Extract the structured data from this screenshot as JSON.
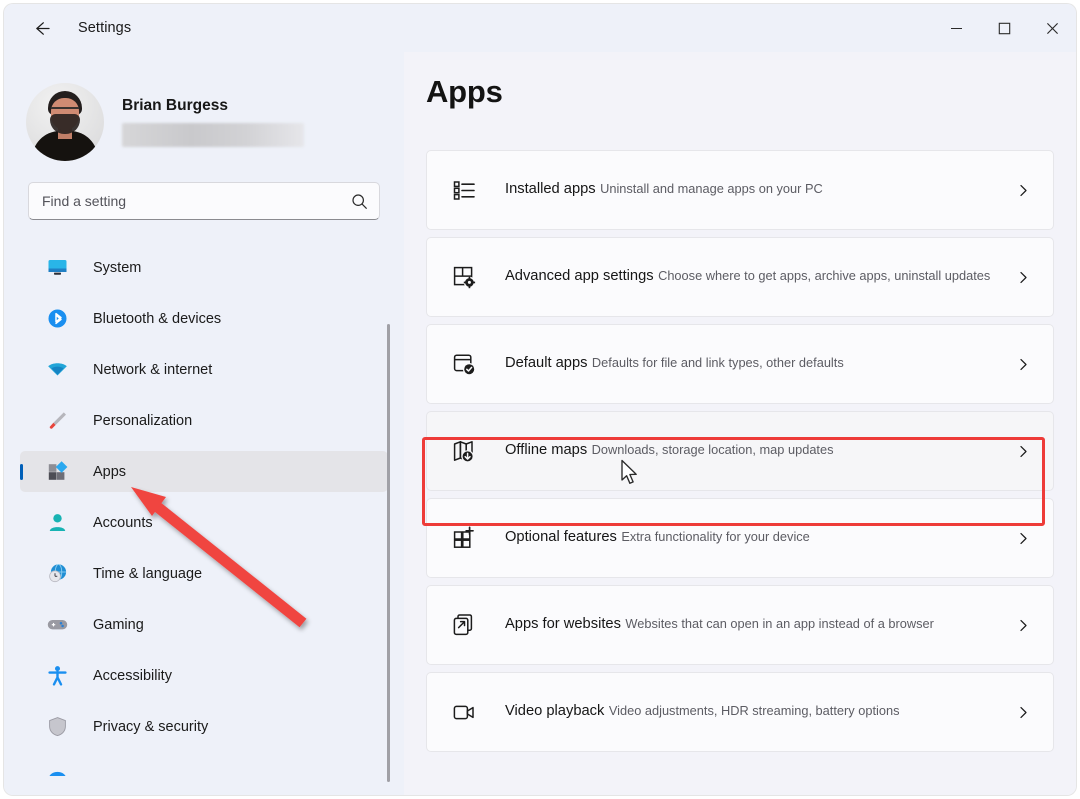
{
  "window": {
    "title": "Settings",
    "back_icon": "back-arrow-icon",
    "controls": {
      "minimize": "minimize-icon",
      "maximize": "maximize-icon",
      "close": "close-icon"
    }
  },
  "account": {
    "name": "Brian Burgess",
    "email_redacted": ""
  },
  "search": {
    "value": "",
    "placeholder": "Find a setting",
    "icon": "search-icon"
  },
  "sidebar": {
    "items": [
      {
        "label": "System",
        "icon": "monitor-icon",
        "selected": false
      },
      {
        "label": "Bluetooth & devices",
        "icon": "bluetooth-icon",
        "selected": false
      },
      {
        "label": "Network & internet",
        "icon": "wifi-icon",
        "selected": false
      },
      {
        "label": "Personalization",
        "icon": "paintbrush-icon",
        "selected": false
      },
      {
        "label": "Apps",
        "icon": "apps-blocks-icon",
        "selected": true
      },
      {
        "label": "Accounts",
        "icon": "person-icon",
        "selected": false
      },
      {
        "label": "Time & language",
        "icon": "clock-globe-icon",
        "selected": false
      },
      {
        "label": "Gaming",
        "icon": "gamepad-icon",
        "selected": false
      },
      {
        "label": "Accessibility",
        "icon": "accessibility-icon",
        "selected": false
      },
      {
        "label": "Privacy & security",
        "icon": "shield-icon",
        "selected": false
      }
    ]
  },
  "main": {
    "title": "Apps",
    "cards": [
      {
        "title": "Installed apps",
        "subtitle": "Uninstall and manage apps on your PC",
        "icon": "list-bullets-icon",
        "highlighted": false
      },
      {
        "title": "Advanced app settings",
        "subtitle": "Choose where to get apps, archive apps, uninstall updates",
        "icon": "app-gear-icon",
        "highlighted": false
      },
      {
        "title": "Default apps",
        "subtitle": "Defaults for file and link types, other defaults",
        "icon": "window-check-icon",
        "highlighted": false
      },
      {
        "title": "Offline maps",
        "subtitle": "Downloads, storage location, map updates",
        "icon": "map-download-icon",
        "highlighted": true
      },
      {
        "title": "Optional features",
        "subtitle": "Extra functionality for your device",
        "icon": "grid-plus-icon",
        "highlighted": false
      },
      {
        "title": "Apps for websites",
        "subtitle": "Websites that can open in an app instead of a browser",
        "icon": "external-link-icon",
        "highlighted": false
      },
      {
        "title": "Video playback",
        "subtitle": "Video adjustments, HDR streaming, battery options",
        "icon": "video-camera-icon",
        "highlighted": false
      }
    ],
    "chevron_icon": "chevron-right-icon"
  },
  "annotations": {
    "highlight_color": "#ee3b38",
    "arrow_color": "#f04440",
    "highlight_target": "Offline maps",
    "arrow_target": "Apps"
  },
  "accent_color": "#005fb8"
}
